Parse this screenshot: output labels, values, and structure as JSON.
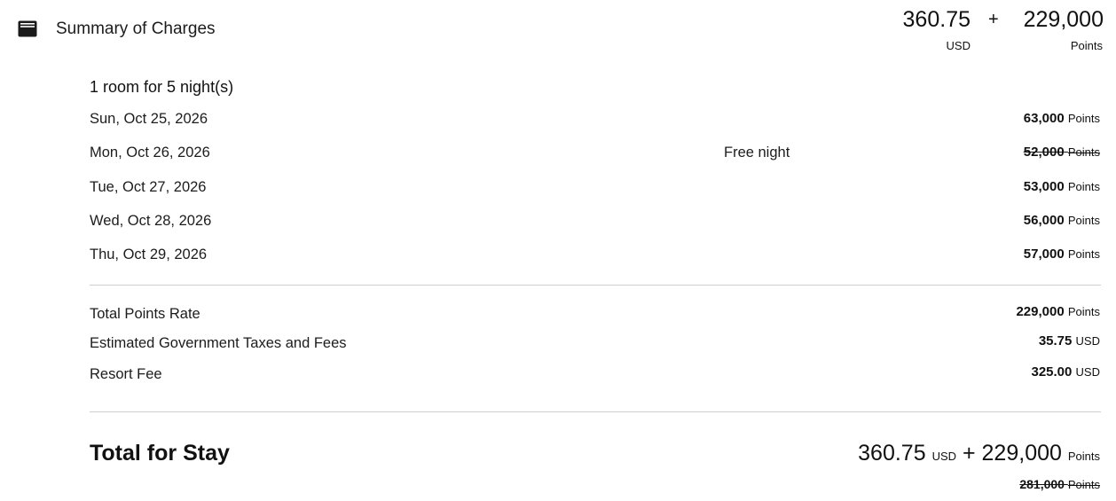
{
  "header": {
    "title": "Summary of Charges",
    "usd_amount": "360.75",
    "usd_label": "USD",
    "plus": "+",
    "points_amount": "229,000",
    "points_label": "Points",
    "icon": "wallet-icon"
  },
  "rooms": {
    "title": "1 room for 5 night(s)",
    "nights": [
      {
        "date": "Sun, Oct 25, 2026",
        "note": "",
        "value": "63,000",
        "unit": "Points",
        "struck": false
      },
      {
        "date": "Mon, Oct 26, 2026",
        "note": "Free night",
        "value": "52,000",
        "unit": "Points",
        "struck": true
      },
      {
        "date": "Tue, Oct 27, 2026",
        "note": "",
        "value": "53,000",
        "unit": "Points",
        "struck": false
      },
      {
        "date": "Wed, Oct 28, 2026",
        "note": "",
        "value": "56,000",
        "unit": "Points",
        "struck": false
      },
      {
        "date": "Thu, Oct 29, 2026",
        "note": "",
        "value": "57,000",
        "unit": "Points",
        "struck": false
      }
    ]
  },
  "charges": [
    {
      "label": "Total Points Rate",
      "value": "229,000",
      "unit": "Points"
    },
    {
      "label": "Estimated Government Taxes and Fees",
      "value": "35.75",
      "unit": "USD"
    },
    {
      "label": "Resort Fee",
      "value": "325.00",
      "unit": "USD"
    }
  ],
  "total": {
    "label": "Total for Stay",
    "usd_amount": "360.75",
    "usd_label": "USD",
    "plus": "+",
    "points_amount": "229,000",
    "points_label": "Points",
    "original_points": "281,000",
    "original_points_label": "Points"
  }
}
